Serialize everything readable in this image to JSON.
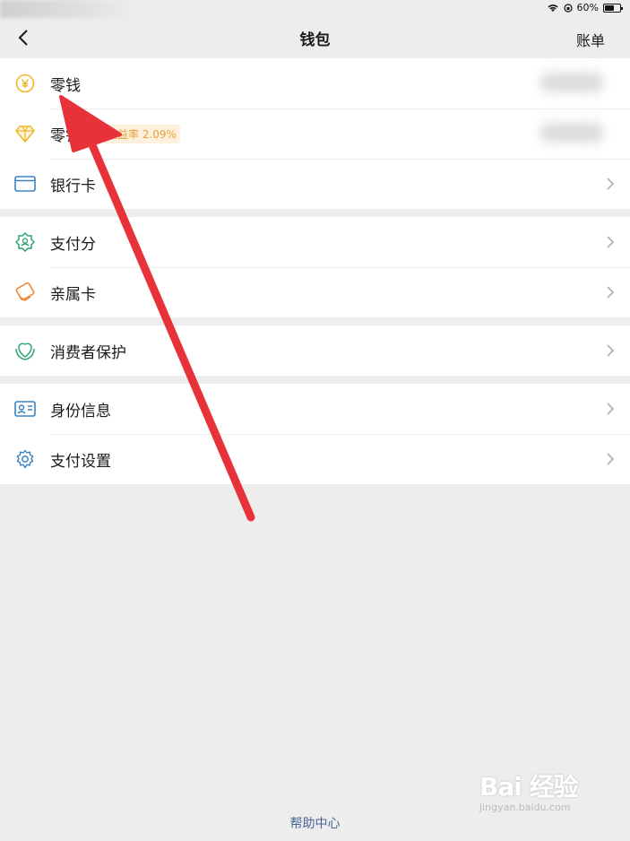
{
  "status_bar": {
    "battery": "60%"
  },
  "nav": {
    "title": "钱包",
    "right_label": "账单"
  },
  "groups": [
    {
      "items": [
        {
          "label": "零钱",
          "icon": "yuan-coin-icon",
          "amount_blurred": true
        },
        {
          "label": "零钱通",
          "icon": "diamond-icon",
          "badge": "收益率 2.09%",
          "amount_blurred": true
        },
        {
          "label": "银行卡",
          "icon": "bank-card-icon"
        }
      ]
    },
    {
      "items": [
        {
          "label": "支付分",
          "icon": "pay-score-icon"
        },
        {
          "label": "亲属卡",
          "icon": "family-card-icon"
        }
      ]
    },
    {
      "items": [
        {
          "label": "消费者保护",
          "icon": "consumer-protection-icon"
        }
      ]
    },
    {
      "items": [
        {
          "label": "身份信息",
          "icon": "id-info-icon"
        },
        {
          "label": "支付设置",
          "icon": "settings-gear-icon"
        }
      ]
    }
  ],
  "footer": {
    "help_label": "帮助中心"
  },
  "watermark": {
    "main": "Bai 经验",
    "sub": "jingyan.baidu.com"
  },
  "colors": {
    "background": "#ededed",
    "arrow": "#e8323a",
    "help_link": "#4a6591",
    "badge": "#e6a23c"
  }
}
